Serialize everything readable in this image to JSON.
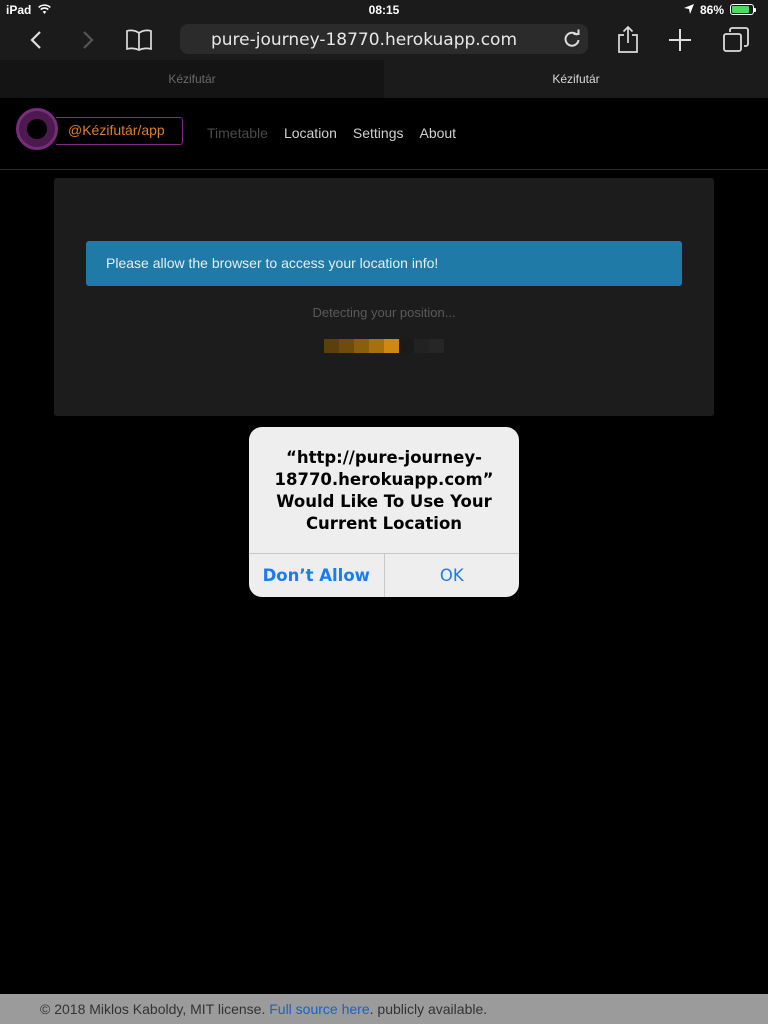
{
  "status_bar": {
    "device": "iPad",
    "time": "08:15",
    "battery_percent": "86%",
    "battery_level": 0.86
  },
  "browser": {
    "url": "pure-journey-18770.herokuapp.com",
    "tabs": [
      {
        "title": "Kézifutár",
        "active": false
      },
      {
        "title": "Kézifutár",
        "active": true
      }
    ]
  },
  "app": {
    "logo_text": "@Kézifutár/app",
    "nav": [
      "Timetable",
      "Location",
      "Settings",
      "About"
    ]
  },
  "content": {
    "alert": "Please allow the browser to access your location info!",
    "detecting": "Detecting your position...",
    "loader_colors": [
      "#5c400c",
      "#6f4c0c",
      "#8a5e0e",
      "#a86f0f",
      "#d08810",
      "#1a1a1a",
      "#222",
      "#262626"
    ]
  },
  "dialog": {
    "title": "“http://pure-journey-18770.herokuapp.com” Would Like To Use Your Current Location",
    "deny_label": "Don’t Allow",
    "ok_label": "OK"
  },
  "footer": {
    "prefix": "© 2018 Miklos Kaboldy, MIT license.",
    "link": "Full source here",
    "suffix": ". publicly available."
  }
}
